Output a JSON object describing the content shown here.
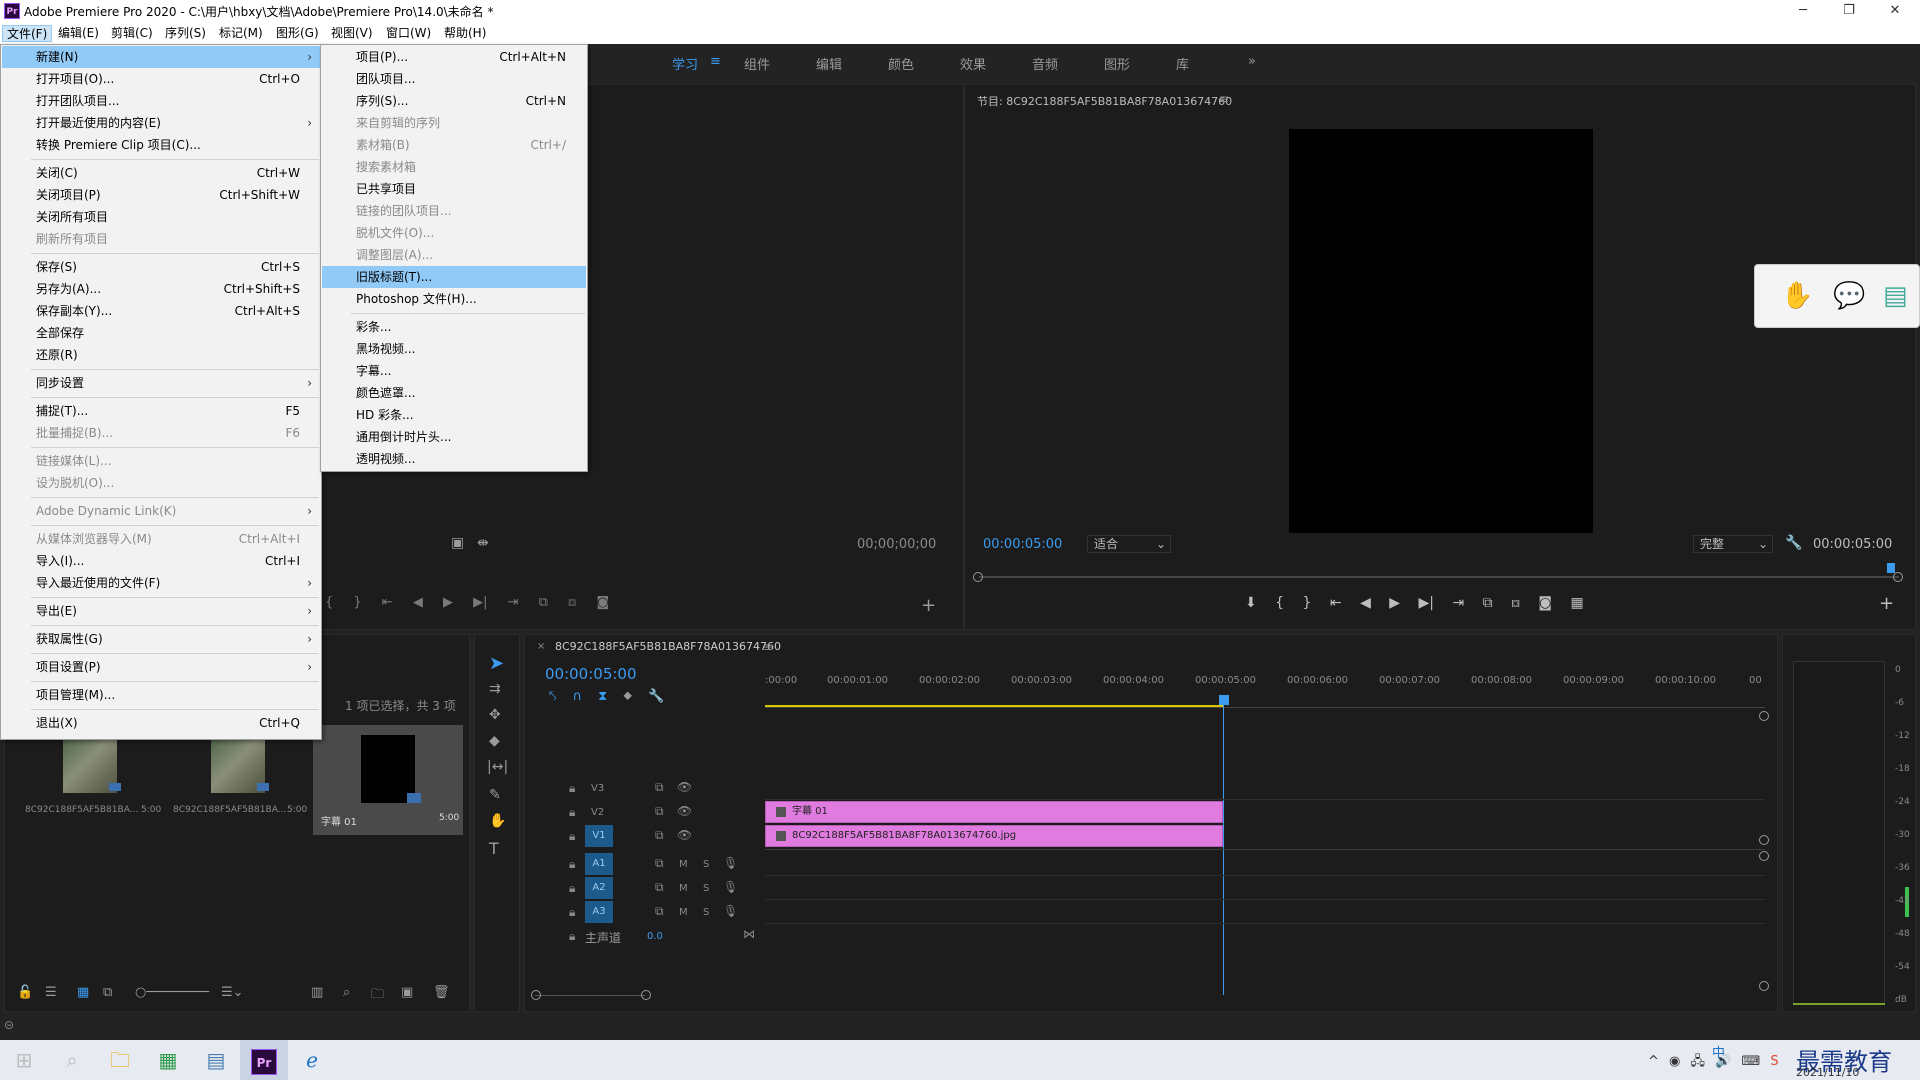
{
  "window": {
    "title": "Adobe Premiere Pro 2020 - C:\\用户\\hbxy\\文档\\Adobe\\Premiere Pro\\14.0\\未命名 *",
    "app_icon": "Pr"
  },
  "menubar": [
    "文件(F)",
    "编辑(E)",
    "剪辑(C)",
    "序列(S)",
    "标记(M)",
    "图形(G)",
    "视图(V)",
    "窗口(W)",
    "帮助(H)"
  ],
  "workspaces": [
    "学习",
    "组件",
    "编辑",
    "颜色",
    "效果",
    "音频",
    "图形",
    "库"
  ],
  "file_menu": [
    {
      "label": "新建(N)",
      "shortcut": "",
      "submenu": true,
      "highlighted": true
    },
    {
      "label": "打开项目(O)...",
      "shortcut": "Ctrl+O"
    },
    {
      "label": "打开团队项目..."
    },
    {
      "label": "打开最近使用的内容(E)",
      "submenu": true
    },
    {
      "label": "转换 Premiere Clip 项目(C)..."
    },
    {
      "label": "关闭(C)",
      "shortcut": "Ctrl+W"
    },
    {
      "label": "关闭项目(P)",
      "shortcut": "Ctrl+Shift+W"
    },
    {
      "label": "关闭所有项目"
    },
    {
      "label": "刷新所有项目",
      "disabled": true
    },
    {
      "label": "保存(S)",
      "shortcut": "Ctrl+S"
    },
    {
      "label": "另存为(A)...",
      "shortcut": "Ctrl+Shift+S"
    },
    {
      "label": "保存副本(Y)...",
      "shortcut": "Ctrl+Alt+S"
    },
    {
      "label": "全部保存"
    },
    {
      "label": "还原(R)"
    },
    {
      "label": "同步设置",
      "submenu": true
    },
    {
      "label": "捕捉(T)...",
      "shortcut": "F5"
    },
    {
      "label": "批量捕捉(B)...",
      "shortcut": "F6",
      "disabled": true
    },
    {
      "label": "链接媒体(L)...",
      "disabled": true
    },
    {
      "label": "设为脱机(O)...",
      "disabled": true
    },
    {
      "label": "Adobe Dynamic Link(K)",
      "submenu": true,
      "disabled": true
    },
    {
      "label": "从媒体浏览器导入(M)",
      "shortcut": "Ctrl+Alt+I",
      "disabled": true
    },
    {
      "label": "导入(I)...",
      "shortcut": "Ctrl+I"
    },
    {
      "label": "导入最近使用的文件(F)",
      "submenu": true
    },
    {
      "label": "导出(E)",
      "submenu": true
    },
    {
      "label": "获取属性(G)",
      "submenu": true
    },
    {
      "label": "项目设置(P)",
      "submenu": true
    },
    {
      "label": "项目管理(M)..."
    },
    {
      "label": "退出(X)",
      "shortcut": "Ctrl+Q"
    }
  ],
  "new_submenu": [
    {
      "label": "项目(P)...",
      "shortcut": "Ctrl+Alt+N"
    },
    {
      "label": "团队项目..."
    },
    {
      "label": "序列(S)...",
      "shortcut": "Ctrl+N"
    },
    {
      "label": "来自剪辑的序列",
      "disabled": true
    },
    {
      "label": "素材箱(B)",
      "shortcut": "Ctrl+/",
      "disabled": true
    },
    {
      "label": "搜索素材箱",
      "disabled": true
    },
    {
      "label": "已共享项目"
    },
    {
      "label": "链接的团队项目...",
      "disabled": true
    },
    {
      "label": "脱机文件(O)...",
      "disabled": true
    },
    {
      "label": "调整图层(A)...",
      "disabled": true
    },
    {
      "label": "旧版标题(T)...",
      "highlighted": true
    },
    {
      "label": "Photoshop 文件(H)..."
    },
    {
      "label": "彩条..."
    },
    {
      "label": "黑场视频..."
    },
    {
      "label": "字幕..."
    },
    {
      "label": "颜色遮罩..."
    },
    {
      "label": "HD 彩条..."
    },
    {
      "label": "通用倒计时片头..."
    },
    {
      "label": "透明视频..."
    }
  ],
  "source_monitor": {
    "timecode": "00;00;00;00"
  },
  "program_monitor": {
    "title": "节目: 8C92C188F5AF5B81BA8F78A013674760",
    "timecode_left": "00:00:05:00",
    "fit": "适合",
    "quality": "完整",
    "timecode_right": "00:00:05:00"
  },
  "project_panel": {
    "selection_info": "1 项已选择，共 3 项",
    "items": [
      {
        "name": "8C92C188F5AF5B81BA...",
        "duration": "5:00"
      },
      {
        "name": "8C92C188F5AF5B81BA...",
        "duration": "5:00"
      },
      {
        "name": "字幕 01",
        "duration": "5:00"
      }
    ]
  },
  "timeline": {
    "tab": "8C92C188F5AF5B81BA8F78A013674760",
    "timecode": "00:00:05:00",
    "ruler": [
      ":00:00",
      "00:00:01:00",
      "00:00:02:00",
      "00:00:03:00",
      "00:00:04:00",
      "00:00:05:00",
      "00:00:06:00",
      "00:00:07:00",
      "00:00:08:00",
      "00:00:09:00",
      "00:00:10:00",
      "00"
    ],
    "video_tracks": [
      "V3",
      "V2",
      "V1"
    ],
    "audio_tracks": [
      "A1",
      "A2",
      "A3"
    ],
    "master": {
      "label": "主声道",
      "value": "0.0"
    },
    "clips": [
      {
        "track": "V2",
        "name": "字幕 01"
      },
      {
        "track": "V1",
        "name": "8C92C188F5AF5B81BA8F78A013674760.jpg"
      }
    ]
  },
  "meter_scale": [
    "0",
    "-6",
    "-12",
    "-18",
    "-24",
    "-30",
    "-36",
    "-42",
    "-48",
    "-54",
    "dB"
  ],
  "taskbar": {
    "date": "2021/11/10",
    "ime": "中",
    "watermark": "最需教育"
  },
  "colors": {
    "accent": "#3b9bf0",
    "clip": "#e07cdf",
    "menu_highlight": "#91c9f7"
  }
}
